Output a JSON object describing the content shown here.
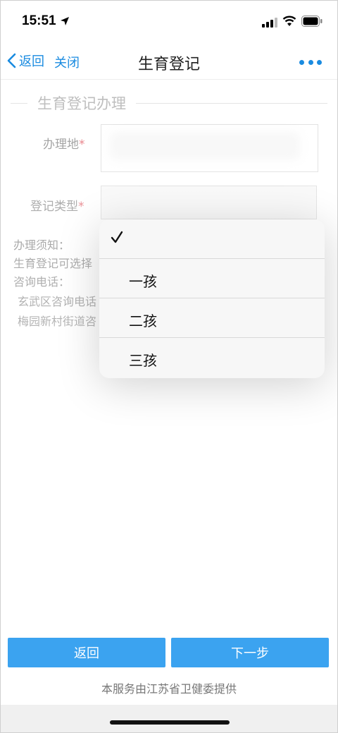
{
  "status_bar": {
    "time": "15:51",
    "icons": [
      "location-arrow-icon",
      "signal-icon",
      "wifi-icon",
      "battery-icon"
    ]
  },
  "nav": {
    "back_label": "返回",
    "close_label": "关闭",
    "title": "生育登记",
    "more_icon": "more-dots-icon"
  },
  "form": {
    "section_title": "生育登记办理",
    "location_label": "办理地",
    "type_label": "登记类型",
    "required_mark": "*"
  },
  "notice": {
    "line1": "办理须知：",
    "line2": "生育登记可选择",
    "line3": "咨询电话：",
    "line4": "玄武区咨询电话",
    "line5": "梅园新村街道咨"
  },
  "dropdown": {
    "options": [
      {
        "label": "",
        "selected": true
      },
      {
        "label": "一孩",
        "selected": false
      },
      {
        "label": "二孩",
        "selected": false
      },
      {
        "label": "三孩",
        "selected": false
      }
    ]
  },
  "buttons": {
    "back": "返回",
    "next": "下一步"
  },
  "footer": "本服务由江苏省卫健委提供",
  "colors": {
    "accent": "#1a8be0",
    "button": "#3ba3f0",
    "required": "#d9333f"
  }
}
